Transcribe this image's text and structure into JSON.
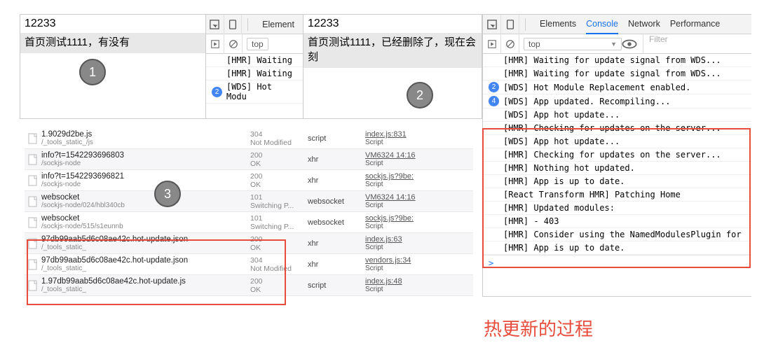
{
  "pane1": {
    "title": "12233",
    "sub": "首页测试1111，有没有",
    "devtabs": [
      "Element"
    ],
    "ctx": "top",
    "logs": [
      {
        "t": "[HMR] Waiting"
      },
      {
        "t": "[HMR] Waiting"
      },
      {
        "b": "2",
        "t": "[WDS] Hot Modu"
      }
    ]
  },
  "pane2": {
    "title": "12233",
    "sub": "首页测试1111，已经删除了，现在会刻",
    "devtabs": [
      "Elements",
      "Console",
      "Network",
      "Performance"
    ],
    "seltab": 1,
    "ctx": "top",
    "filter_ph": "Filter",
    "logs": [
      {
        "t": "[HMR] Waiting for update signal from WDS..."
      },
      {
        "t": "[HMR] Waiting for update signal from WDS..."
      },
      {
        "b": "2",
        "t": "[WDS] Hot Module Replacement enabled."
      },
      {
        "b": "4",
        "t": "[WDS] App updated. Recompiling..."
      },
      {
        "t": "[WDS] App hot update..."
      },
      {
        "t": "[HMR] Checking for updates on the server..."
      },
      {
        "t": "[WDS] App hot update..."
      },
      {
        "t": "[HMR] Checking for updates on the server..."
      },
      {
        "t": "[HMR] Nothing hot updated."
      },
      {
        "t": "[HMR] App is up to date."
      },
      {
        "t": "[React Transform HMR] Patching Home"
      },
      {
        "t": "[HMR] Updated modules:"
      },
      {
        "t": "[HMR]  - 403"
      },
      {
        "t": "[HMR] Consider using the NamedModulesPlugin for"
      },
      {
        "t": "[HMR] App is up to date."
      }
    ]
  },
  "net": [
    {
      "n": "1.9029d2be.js",
      "p": "/_tools_static_/js",
      "s": "304",
      "st": "Not Modified",
      "ty": "script",
      "i1": "index.js:831",
      "i2": "Script"
    },
    {
      "n": "info?t=1542293696803",
      "p": "/sockjs-node",
      "s": "200",
      "st": "OK",
      "ty": "xhr",
      "i1": "VM6324 14:16",
      "i2": "Script"
    },
    {
      "n": "info?t=1542293696821",
      "p": "/sockjs-node",
      "s": "200",
      "st": "OK",
      "ty": "xhr",
      "i1": "sockjs.js?9be:",
      "i2": "Script"
    },
    {
      "n": "websocket",
      "p": "/sockjs-node/024/hbl340cb",
      "s": "101",
      "st": "Switching P...",
      "ty": "websocket",
      "i1": "VM6324 14:16",
      "i2": "Script"
    },
    {
      "n": "websocket",
      "p": "/sockjs-node/515/s1eunnb",
      "s": "101",
      "st": "Switching P...",
      "ty": "websocket",
      "i1": "sockjs.js?9be:",
      "i2": "Script"
    },
    {
      "n": "97db99aab5d6c08ae42c.hot-update.json",
      "p": "/_tools_static_",
      "s": "200",
      "st": "OK",
      "ty": "xhr",
      "i1": "index.js:63",
      "i2": "Script"
    },
    {
      "n": "97db99aab5d6c08ae42c.hot-update.json",
      "p": "/_tools_static_",
      "s": "304",
      "st": "Not Modified",
      "ty": "xhr",
      "i1": "vendors.js:34",
      "i2": "Script"
    },
    {
      "n": "1.97db99aab5d6c08ae42c.hot-update.js",
      "p": "/_tools_static_",
      "s": "200",
      "st": "OK",
      "ty": "script",
      "i1": "index.js:48",
      "i2": "Script"
    }
  ],
  "bottom_text": "热更新的过程",
  "badges": {
    "n1": "1",
    "n2": "2",
    "n3": "3"
  }
}
